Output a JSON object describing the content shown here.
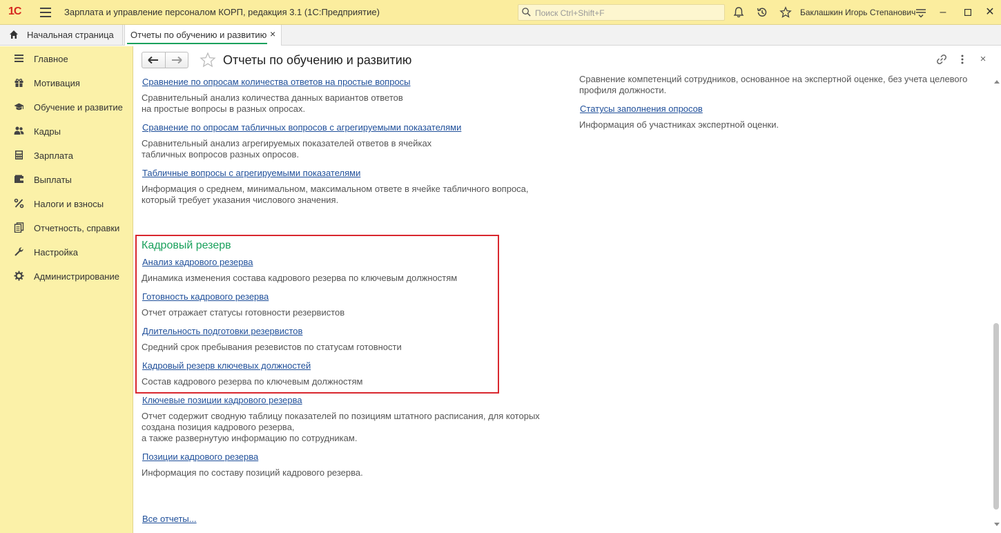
{
  "titlebar": {
    "logo": "1С",
    "app_title": "Зарплата и управление персоналом КОРП, редакция 3.1  (1С:Предприятие)",
    "search_placeholder": "Поиск Ctrl+Shift+F",
    "user": "Баклашкин Игорь Степанович"
  },
  "tabs": {
    "home_label": "Начальная страница",
    "doc_label": "Отчеты по обучению и развитию",
    "close_glyph": "×"
  },
  "sidebar": {
    "items": [
      {
        "label": "Главное",
        "icon": "menu-lines-icon"
      },
      {
        "label": "Мотивация",
        "icon": "gift-icon"
      },
      {
        "label": "Обучение и развитие",
        "icon": "graduation-cap-icon"
      },
      {
        "label": "Кадры",
        "icon": "people-icon"
      },
      {
        "label": "Зарплата",
        "icon": "calculator-icon"
      },
      {
        "label": "Выплаты",
        "icon": "wallet-icon"
      },
      {
        "label": "Налоги и взносы",
        "icon": "percent-icon"
      },
      {
        "label": "Отчетность, справки",
        "icon": "documents-icon"
      },
      {
        "label": "Настройка",
        "icon": "wrench-icon"
      },
      {
        "label": "Администрирование",
        "icon": "gear-icon"
      }
    ]
  },
  "header": {
    "title": "Отчеты по обучению и развитию"
  },
  "left_column": {
    "top_reports": [
      {
        "link": "Сравнение по опросам количества ответов на простые вопросы",
        "desc": [
          "Сравнительный анализ количества данных вариантов ответов",
          "на простые вопросы в разных опросах."
        ]
      },
      {
        "link": "Сравнение по опросам табличных вопросов с агрегируемыми показателями",
        "desc": [
          "Сравнительный анализ агрегируемых показателей ответов в ячейках",
          "табличных вопросов разных опросов."
        ]
      },
      {
        "link": "Табличные вопросы с агрегируемыми показателями",
        "desc": [
          "Информация о среднем, минимальном, максимальном ответе в ячейке табличного вопроса,",
          "который требует указания числового значения."
        ]
      }
    ],
    "reserve_group": {
      "title": "Кадровый резерв",
      "reports": [
        {
          "link": "Анализ кадрового резерва",
          "desc": "Динамика изменения состава кадрового резерва по ключевым должностям"
        },
        {
          "link": "Готовность кадрового резерва",
          "desc": "Отчет отражает статусы готовности резервистов"
        },
        {
          "link": "Длительность подготовки резервистов",
          "desc": "Средний срок пребывания резевистов по статусам готовности"
        },
        {
          "link": "Кадровый резерв ключевых должностей",
          "desc": "Состав кадрового резерва по ключевым должностям"
        }
      ]
    },
    "after_reports": [
      {
        "link": "Ключевые позиции кадрового резерва",
        "desc": [
          "Отчет содержит сводную таблицу показателей по позициям штатного расписания, для которых",
          "создана позиция кадрового резерва,",
          "а также развернутую информацию по сотрудникам."
        ]
      },
      {
        "link": "Позиции кадрового резерва",
        "desc": [
          "Информация по составу позиций кадрового резерва."
        ]
      }
    ],
    "all_reports": "Все отчеты..."
  },
  "right_column": {
    "top_desc": [
      "Сравнение компетенций сотрудников, основанное на экспертной оценке, без учета целевого",
      "профиля должности."
    ],
    "status_link": "Статусы заполнения опросов",
    "status_desc": "Информация об участниках экспертной оценки."
  },
  "colors": {
    "titlebar_bg": "#fbed9e",
    "sidebar_bg": "#fbf1a8",
    "link": "#1f4f9a",
    "group_title": "#1aa15c",
    "highlight_border": "#d9272e"
  }
}
